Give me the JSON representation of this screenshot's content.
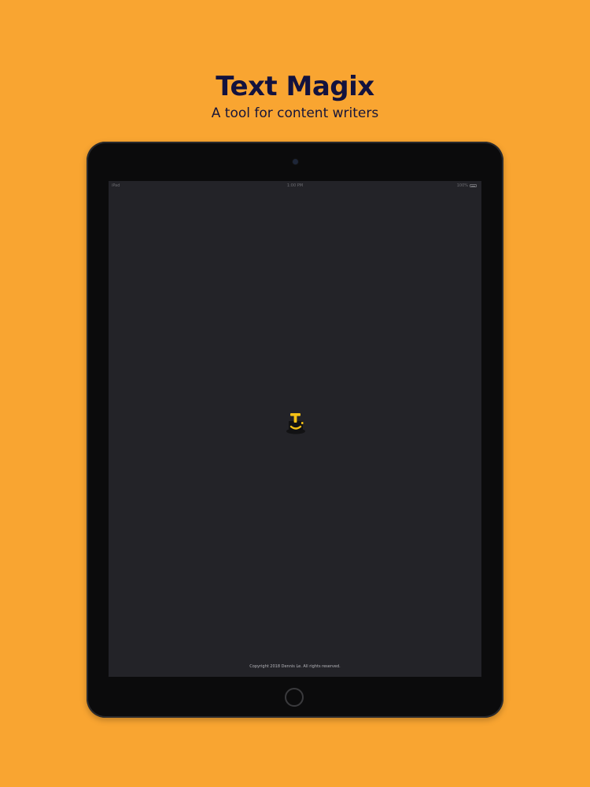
{
  "header": {
    "title": "Text Magix",
    "subtitle": "A tool for content writers"
  },
  "device": {
    "status_bar": {
      "carrier": "iPad",
      "time": "1:00 PM",
      "battery": "100%"
    },
    "screen": {
      "logo_icon": "text-magix-hat-icon",
      "copyright": "Copyright 2018 Dennis Le. All rights reserved."
    }
  },
  "colors": {
    "background": "#f9a531",
    "title": "#13123e",
    "device_bezel": "#0b0b0c",
    "screen": "#232328",
    "logo_yellow": "#f5c116"
  }
}
